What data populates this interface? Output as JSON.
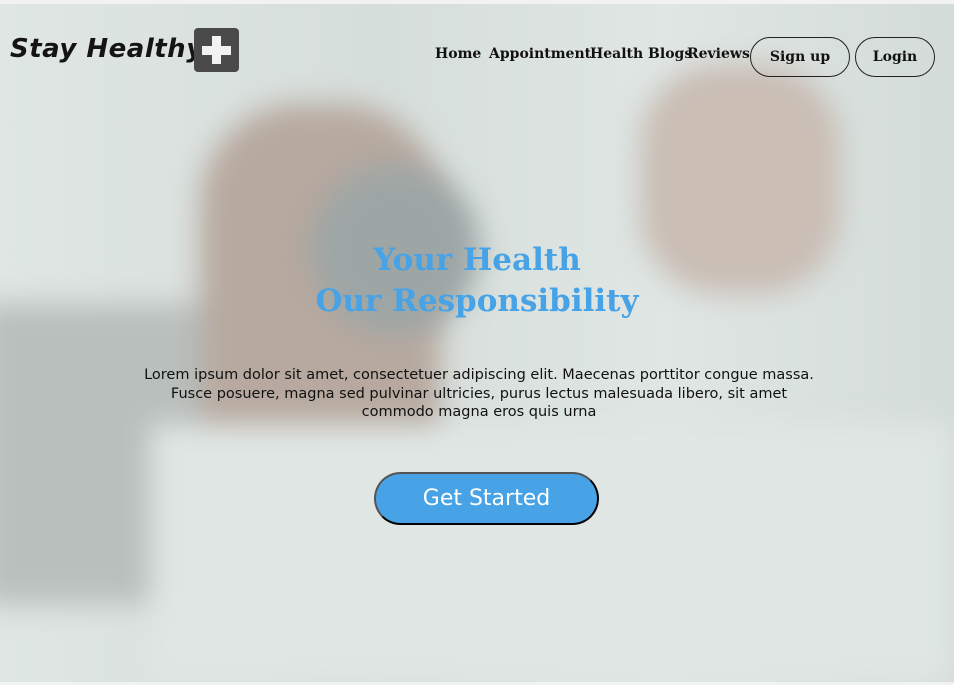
{
  "brand": {
    "name": "Stay Healthy",
    "icon": "plus-square-icon"
  },
  "nav": {
    "links": [
      "Home",
      "Appointment",
      "Health Blogs",
      "Reviews"
    ],
    "signup": "Sign up",
    "login": "Login"
  },
  "hero": {
    "title_line1": "Your Health",
    "title_line2": "Our Responsibility",
    "description": "Lorem ipsum dolor sit amet, consectetuer adipiscing elit. Maecenas porttitor congue massa. Fusce posuere, magna sed pulvinar ultricies, purus lectus malesuada libero, sit amet commodo magna eros quis urna",
    "cta": "Get Started"
  },
  "colors": {
    "accent": "#47a2e6"
  }
}
